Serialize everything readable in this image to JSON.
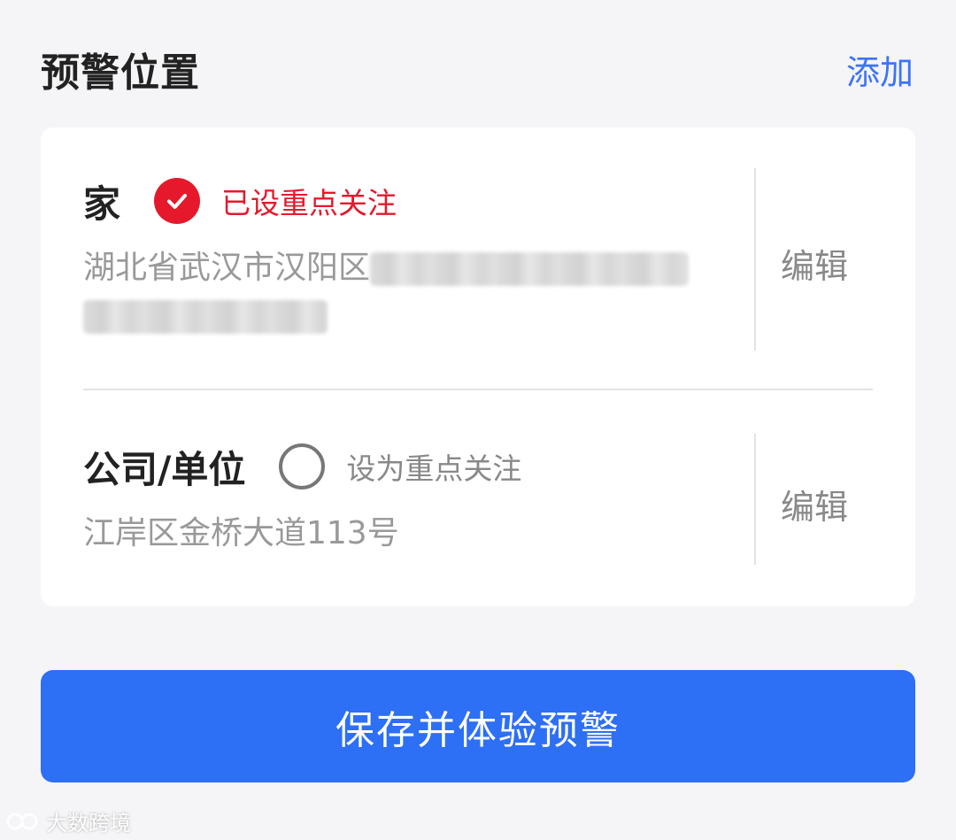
{
  "header": {
    "title": "预警位置",
    "add_label": "添加"
  },
  "locations": [
    {
      "name": "家",
      "focus_state": "checked",
      "focus_label": "已设重点关注",
      "address_visible": "湖北省武汉市汉阳区",
      "address_redacted": true,
      "edit_label": "编辑"
    },
    {
      "name": "公司/单位",
      "focus_state": "unchecked",
      "focus_label": "设为重点关注",
      "address_visible": "江岸区金桥大道113号",
      "address_redacted": false,
      "edit_label": "编辑"
    }
  ],
  "primary_action": {
    "label": "保存并体验预警"
  },
  "watermark": {
    "text": "大数跨境"
  },
  "colors": {
    "accent_blue": "#3d74f6",
    "button_blue": "#2d6ff5",
    "focus_red": "#e5192b",
    "background": "#f5f5f7"
  }
}
